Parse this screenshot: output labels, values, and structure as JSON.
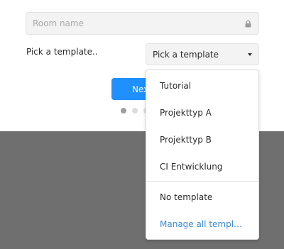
{
  "room_name": {
    "value": "",
    "placeholder": "Room name",
    "icon": "lock-icon"
  },
  "template": {
    "label": "Pick a template..",
    "select_label": "Pick a template",
    "caret_icon": "caret-down-icon"
  },
  "next_button": {
    "label": "Next"
  },
  "stepper": {
    "total": 3,
    "active": 0
  },
  "dropdown": {
    "items": [
      {
        "label": "Tutorial"
      },
      {
        "label": "Projekttyp A"
      },
      {
        "label": "Projekttyp B"
      },
      {
        "label": "CI Entwicklung"
      }
    ],
    "no_template": "No template",
    "manage_link": "Manage all templ…"
  },
  "colors": {
    "accent": "#1e90ff",
    "link": "#3d8bd6",
    "backdrop": "#6f6f6f"
  }
}
